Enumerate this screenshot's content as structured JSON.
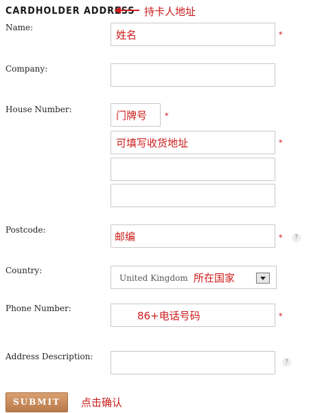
{
  "heading": "CARDHOLDER ADDRESS",
  "heading_annotation": "持卡人地址",
  "fields": {
    "name": {
      "label": "Name:",
      "value": "姓名"
    },
    "company": {
      "label": "Company:",
      "value": ""
    },
    "house_number": {
      "label": "House Number:",
      "value": "门牌号"
    },
    "address_line1": {
      "value": "可填写收货地址"
    },
    "address_line2": {
      "value": ""
    },
    "address_line3": {
      "value": ""
    },
    "postcode": {
      "label": "Postcode:",
      "value": "邮编"
    },
    "country": {
      "label": "Country:",
      "value": "United Kingdom",
      "annotation": "所在国家"
    },
    "phone": {
      "label": "Phone Number:",
      "value": "86+电话号码"
    },
    "address_description": {
      "label": "Address Description:",
      "value": ""
    }
  },
  "required_mark": "*",
  "help_mark": "?",
  "submit": {
    "label": "SUBMIT",
    "annotation": "点击确认"
  },
  "colors": {
    "annotation_red": "#cc1a1a",
    "submit_button": "#c98b5c",
    "border": "#c8c8c8"
  },
  "icons": {
    "heading_arrow": "left-arrow-icon",
    "country_dropdown": "chevron-down-icon",
    "help": "help-icon"
  }
}
